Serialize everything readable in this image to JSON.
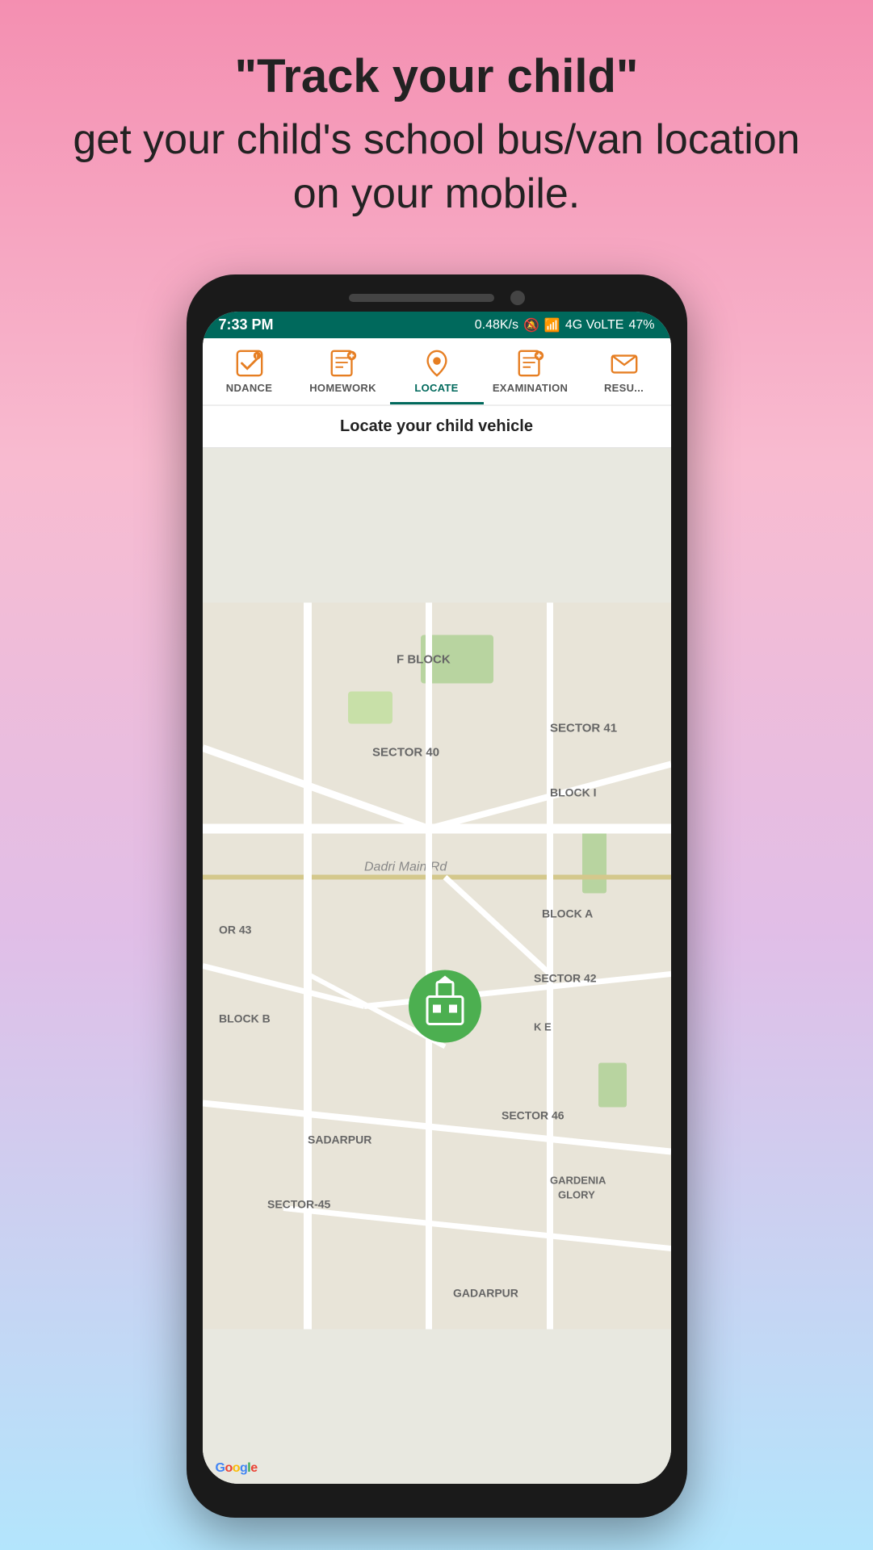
{
  "background": {
    "gradient_start": "#f48fb1",
    "gradient_end": "#b3e5fc"
  },
  "top_text": {
    "headline": "\"Track your child\"",
    "subline": "get your child's school bus/van location on your mobile."
  },
  "status_bar": {
    "time": "7:33 PM",
    "network_speed": "0.48K/s",
    "signal": "4G VoLTE",
    "battery": "47%"
  },
  "nav_tabs": [
    {
      "id": "attendance",
      "label": "NDANCE",
      "active": false
    },
    {
      "id": "homework",
      "label": "HOMEWORK",
      "active": false
    },
    {
      "id": "locate",
      "label": "LOCATE",
      "active": true
    },
    {
      "id": "examination",
      "label": "EXAMINATION",
      "active": false
    },
    {
      "id": "result",
      "label": "RESU...",
      "active": false
    }
  ],
  "page_title": "Locate your child vehicle",
  "map": {
    "labels": [
      "F BLOCK",
      "SECTOR 41",
      "SECTOR 40",
      "Dadri Main Rd",
      "BLOCK I",
      "OR 43",
      "BLOCK A",
      "BLOCK B",
      "SECTOR 42",
      "K E",
      "SADARPUR",
      "SECTOR 46",
      "SECTOR-45",
      "GARDENIA GLORY",
      "GADARPUR"
    ]
  },
  "google_label": "Google"
}
